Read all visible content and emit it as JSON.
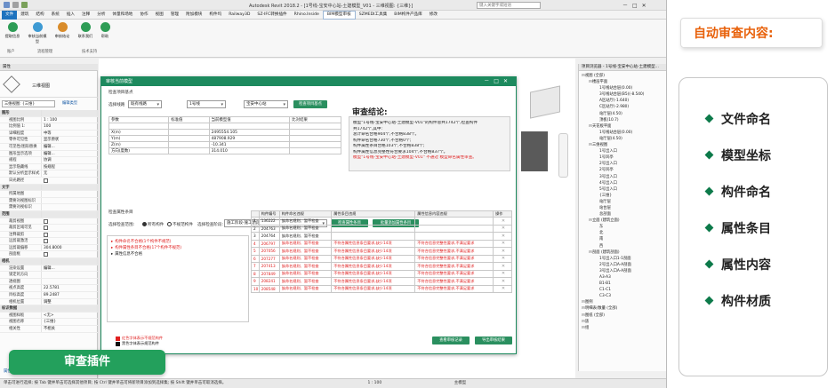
{
  "app": {
    "window_title": "Autodesk Revit 2018.2 - [1号线-宝安中心站-土建模型_V01 - 三维视图: {三维}]",
    "search_placeholder": "键入关键字或短语",
    "menus": [
      "文件",
      "建筑",
      "结构",
      "系统",
      "插入",
      "注释",
      "分析",
      "体量和场地",
      "协作",
      "视图",
      "管理",
      "附加模块",
      "构件坞",
      "Railway3D",
      "SZ-IFC转换插件",
      "Rhino.Inside",
      "BIM模型审核",
      "SZMEDI工具集",
      "BIM构件产品库",
      "修改"
    ],
    "active_menu": "BIM模型审核",
    "ribbon_buttons": [
      "提取信息",
      "审核当前模型",
      "审核结论",
      "联系我们",
      "帮助"
    ],
    "ribbon_groups": [
      "账户",
      "流程管理",
      "技术支持"
    ]
  },
  "properties": {
    "header": "属性",
    "type_name": "三维视图",
    "instance_label": "三维视图: {三维}",
    "edit_type": "编辑类型",
    "rows": [
      {
        "k": "图形",
        "v": "",
        "cat": true
      },
      {
        "k": "视图比例",
        "v": "1 : 100"
      },
      {
        "k": "比例值 1:",
        "v": "100"
      },
      {
        "k": "详细程度",
        "v": "中等"
      },
      {
        "k": "零件可见性",
        "v": "显示原状"
      },
      {
        "k": "可见性/图形替换",
        "v": "编辑..."
      },
      {
        "k": "图形显示选项",
        "v": "编辑..."
      },
      {
        "k": "规程",
        "v": "协调"
      },
      {
        "k": "显示隐藏线",
        "v": "按规程"
      },
      {
        "k": "默认分析显示样式",
        "v": "无"
      },
      {
        "k": "日光路径",
        "v": "",
        "cb": true
      },
      {
        "k": "文字",
        "v": "",
        "cat": true
      },
      {
        "k": "所属地图",
        "v": ""
      },
      {
        "k": "需要对视图标识",
        "v": ""
      },
      {
        "k": "需要对视标识",
        "v": ""
      },
      {
        "k": "范围",
        "v": "",
        "cat": true
      },
      {
        "k": "裁剪视图",
        "v": "",
        "cb": true
      },
      {
        "k": "裁剪区域可见",
        "v": "",
        "cb": true
      },
      {
        "k": "注释裁剪",
        "v": "",
        "cb": true
      },
      {
        "k": "远剪裁激活",
        "v": "",
        "cb": true
      },
      {
        "k": "远剪裁偏移",
        "v": "304.8000"
      },
      {
        "k": "剖面框",
        "v": "",
        "cb": true
      },
      {
        "k": "相机",
        "v": "",
        "cat": true
      },
      {
        "k": "渲染设置",
        "v": "编辑..."
      },
      {
        "k": "锁定的方向",
        "v": ""
      },
      {
        "k": "透视图",
        "v": ""
      },
      {
        "k": "视点高度",
        "v": "22.5781"
      },
      {
        "k": "目标高度",
        "v": "89.2487"
      },
      {
        "k": "相机位置",
        "v": "调整"
      },
      {
        "k": "标识数据",
        "v": "",
        "cat": true
      },
      {
        "k": "视图样板",
        "v": "<无>"
      },
      {
        "k": "视图名称",
        "v": "{三维}"
      },
      {
        "k": "相关性",
        "v": "不相关"
      }
    ],
    "help_link": "属性帮助",
    "apply": "应用"
  },
  "browser": {
    "header": "项目浏览器 - 1号线-宝安中心站-土建模型...",
    "nodes": [
      {
        "t": "视图 (全部)",
        "d": 0
      },
      {
        "t": "楼层平面",
        "d": 1
      },
      {
        "t": "1号线站台层(0.00)",
        "d": 2
      },
      {
        "t": "3号线站台层(B5)(-8.540)",
        "d": 2
      },
      {
        "t": "A区站厅(-1.640)",
        "d": 2
      },
      {
        "t": "C区站厅(-2.980)",
        "d": 2
      },
      {
        "t": "站厅层(4.50)",
        "d": 2
      },
      {
        "t": "顶板(10.7)",
        "d": 2
      },
      {
        "t": "天花板平面",
        "d": 1
      },
      {
        "t": "1号线站台层(0.00)",
        "d": 2
      },
      {
        "t": "站厅层(4.50)",
        "d": 2
      },
      {
        "t": "三维视图",
        "d": 1
      },
      {
        "t": "1号出入口",
        "d": 2
      },
      {
        "t": "1号风亭",
        "d": 2
      },
      {
        "t": "2号出入口",
        "d": 2
      },
      {
        "t": "2号风亭",
        "d": 2
      },
      {
        "t": "3号出入口",
        "d": 2
      },
      {
        "t": "4号出入口",
        "d": 2
      },
      {
        "t": "5号出入口",
        "d": 2
      },
      {
        "t": "{三维}",
        "d": 2
      },
      {
        "t": "站厅层",
        "d": 2
      },
      {
        "t": "站台层",
        "d": 2
      },
      {
        "t": "总剖面",
        "d": 2
      },
      {
        "t": "立面 (建筑立面)",
        "d": 1
      },
      {
        "t": "东",
        "d": 2
      },
      {
        "t": "北",
        "d": 2
      },
      {
        "t": "南",
        "d": 2
      },
      {
        "t": "西",
        "d": 2
      },
      {
        "t": "剖面 (建筑剖面)",
        "d": 1
      },
      {
        "t": "1号出入口1-1剖面",
        "d": 2
      },
      {
        "t": "2号出入口A-A剖面",
        "d": 2
      },
      {
        "t": "3号出入口A-A剖面",
        "d": 2
      },
      {
        "t": "A3-A3",
        "d": 2
      },
      {
        "t": "B1-B1",
        "d": 2
      },
      {
        "t": "C1-C1",
        "d": 2
      },
      {
        "t": "C3-C3",
        "d": 2
      },
      {
        "t": "图例",
        "d": 0
      },
      {
        "t": "明细表/数量 (全部)",
        "d": 0
      },
      {
        "t": "图纸 (全部)",
        "d": 0
      },
      {
        "t": "族",
        "d": 0
      },
      {
        "t": "组",
        "d": 0
      }
    ]
  },
  "status": {
    "text": "单击可进行选择; 按 Tab 键并单击可选择其他项目; 按 Ctrl 键并单击可将新项目添加到选择集; 按 Shift 键并单击可取消选择。",
    "scale": "1 : 100",
    "model": "主模型"
  },
  "dialog": {
    "title": "审核当前模型",
    "section1": "检查项目基点",
    "select_line_label": "选择线路",
    "line_value": "既有线路",
    "line_no": "1号线",
    "station": "宝安中心站",
    "check_btn": "检查项目基点",
    "coord_headers": [
      "参数",
      "标准值",
      "当前模型值",
      "比对结果"
    ],
    "coord_rows": [
      {
        "p": "",
        "s": "",
        "c": "",
        "r": ""
      },
      {
        "p": "X(m)",
        "s": "",
        "c": "2495554.105",
        "r": ""
      },
      {
        "p": "Y(m)",
        "s": "",
        "c": "487908.929",
        "r": ""
      },
      {
        "p": "Z(m)",
        "s": "",
        "c": "-10.341",
        "r": ""
      },
      {
        "p": "方向(度数)",
        "s": "",
        "c": "314.010",
        "r": ""
      }
    ],
    "conclusion_title": "审查结论:",
    "conclusion_lines": [
      {
        "t": "模型\"1号线-宝安中心站-土建模型-V01\"的构件总共1742个,检查构件",
        "red": false
      },
      {
        "t": "共1742个,其中:",
        "red": false
      },
      {
        "t": "总计命名合格904个,不合格838个。",
        "red": false
      },
      {
        "t": "构件命名合格730个,不合格0个;",
        "red": false
      },
      {
        "t": "构件属性条目合格103个,不合格838个;",
        "red": false
      },
      {
        "t": "构件属性信息完整性符合要求104个,不合格837个。",
        "red": false
      },
      {
        "t": "模型\"1号线-宝安中心站-土建模型-V01\" 不通过 模型命名属性审查。",
        "red": true
      }
    ],
    "section2": "检查属性条目",
    "mode_label": "选择检查范围:",
    "radio_a": "所有构件",
    "radio_b": "不规范构件",
    "attr_select_label": "选择检查阶段:",
    "attr_select_value": "施工阶段-施工阶段",
    "btn_check_attr": "检查属性条目",
    "btn_batch": "批量添加属性条目",
    "err_items": [
      {
        "t": "构件命名不合格(1个构件不规范)",
        "red": true
      },
      {
        "t": "构件属性条目不合格(17个构件不规范)",
        "red": true
      },
      {
        "t": "属性信息不合格",
        "red": false
      }
    ],
    "res_headers": [
      "",
      "构件编号",
      "构件命名违规",
      "属性条目违规",
      "属性信息内容违规",
      "操作"
    ],
    "res_rows": [
      {
        "n": "1",
        "id": "136222",
        "name": "族命名规则、暂不检查",
        "attr": "",
        "info": "",
        "red": false
      },
      {
        "n": "2",
        "id": "204763",
        "name": "族命名规则、暂不检查",
        "attr": "",
        "info": "",
        "red": false
      },
      {
        "n": "3",
        "id": "204764",
        "name": "族命名规则、暂不检查",
        "attr": "",
        "info": "",
        "red": false
      },
      {
        "n": "4",
        "id": "206797",
        "name": "族命名规则、暂不检查",
        "attr": "不符合属性信息条目要求,缺少14项",
        "info": "不符合信息完整性要求,不满足要求",
        "red": true
      },
      {
        "n": "5",
        "id": "207056",
        "name": "族命名规则、暂不检查",
        "attr": "不符合属性信息条目要求,缺少14项",
        "info": "不符合信息完整性要求,不满足要求",
        "red": true
      },
      {
        "n": "6",
        "id": "207277",
        "name": "族命名规则、暂不检查",
        "attr": "不符合属性信息条目要求,缺少14项",
        "info": "不符合信息完整性要求,不满足要求",
        "red": true
      },
      {
        "n": "7",
        "id": "207413",
        "name": "族命名规则、暂不检查",
        "attr": "不符合属性信息条目要求,缺少14项",
        "info": "不符合信息完整性要求,不满足要求",
        "red": true
      },
      {
        "n": "8",
        "id": "207849",
        "name": "族命名规则、暂不检查",
        "attr": "不符合属性信息条目要求,缺少14项",
        "info": "不符合信息完整性要求,不满足要求",
        "red": true
      },
      {
        "n": "9",
        "id": "208241",
        "name": "族命名规则、暂不检查",
        "attr": "不符合属性信息条目要求,缺少14项",
        "info": "不符合信息完整性要求,不满足要求",
        "red": true
      },
      {
        "n": "10",
        "id": "208548",
        "name": "族命名规则、暂不检查",
        "attr": "不符合属性信息条目要求,缺少14项",
        "info": "不符合信息完整性要求,不满足要求",
        "red": true
      }
    ],
    "legend": [
      {
        "t": "红色字体表示不规范构件",
        "color": "#e02020"
      },
      {
        "t": "黑色字体表示规范构件",
        "color": "#111111"
      }
    ],
    "btn_view_record": "查看审核记录",
    "btn_export": "导出审核结果"
  },
  "badge": "审查插件",
  "panel": {
    "title": "自动审查内容:",
    "items": [
      "文件命名",
      "模型坐标",
      "构件命名",
      "属性条目",
      "属性内容",
      "构件材质"
    ]
  },
  "colors": {
    "accent": "#1d8a5e",
    "brand_green": "#23a05c",
    "orange": "#e8620c",
    "error_red": "#e02020"
  }
}
